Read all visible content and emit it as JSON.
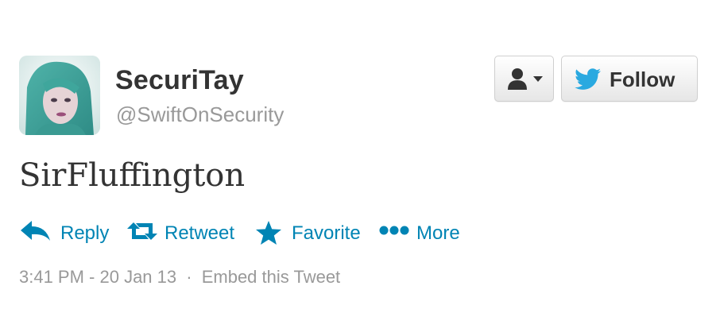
{
  "user": {
    "display_name": "SecuriTay",
    "handle": "@SwiftOnSecurity"
  },
  "buttons": {
    "follow_label": "Follow"
  },
  "tweet": {
    "text": "SirFluffington"
  },
  "actions": {
    "reply": "Reply",
    "retweet": "Retweet",
    "favorite": "Favorite",
    "more": "More"
  },
  "meta": {
    "timestamp": "3:41 PM - 20 Jan 13",
    "separator": "·",
    "embed_label": "Embed this Tweet"
  },
  "colors": {
    "link": "#0084b4",
    "twitter_blue": "#2aa9e0",
    "text_dark": "#333333",
    "text_muted": "#999999"
  }
}
